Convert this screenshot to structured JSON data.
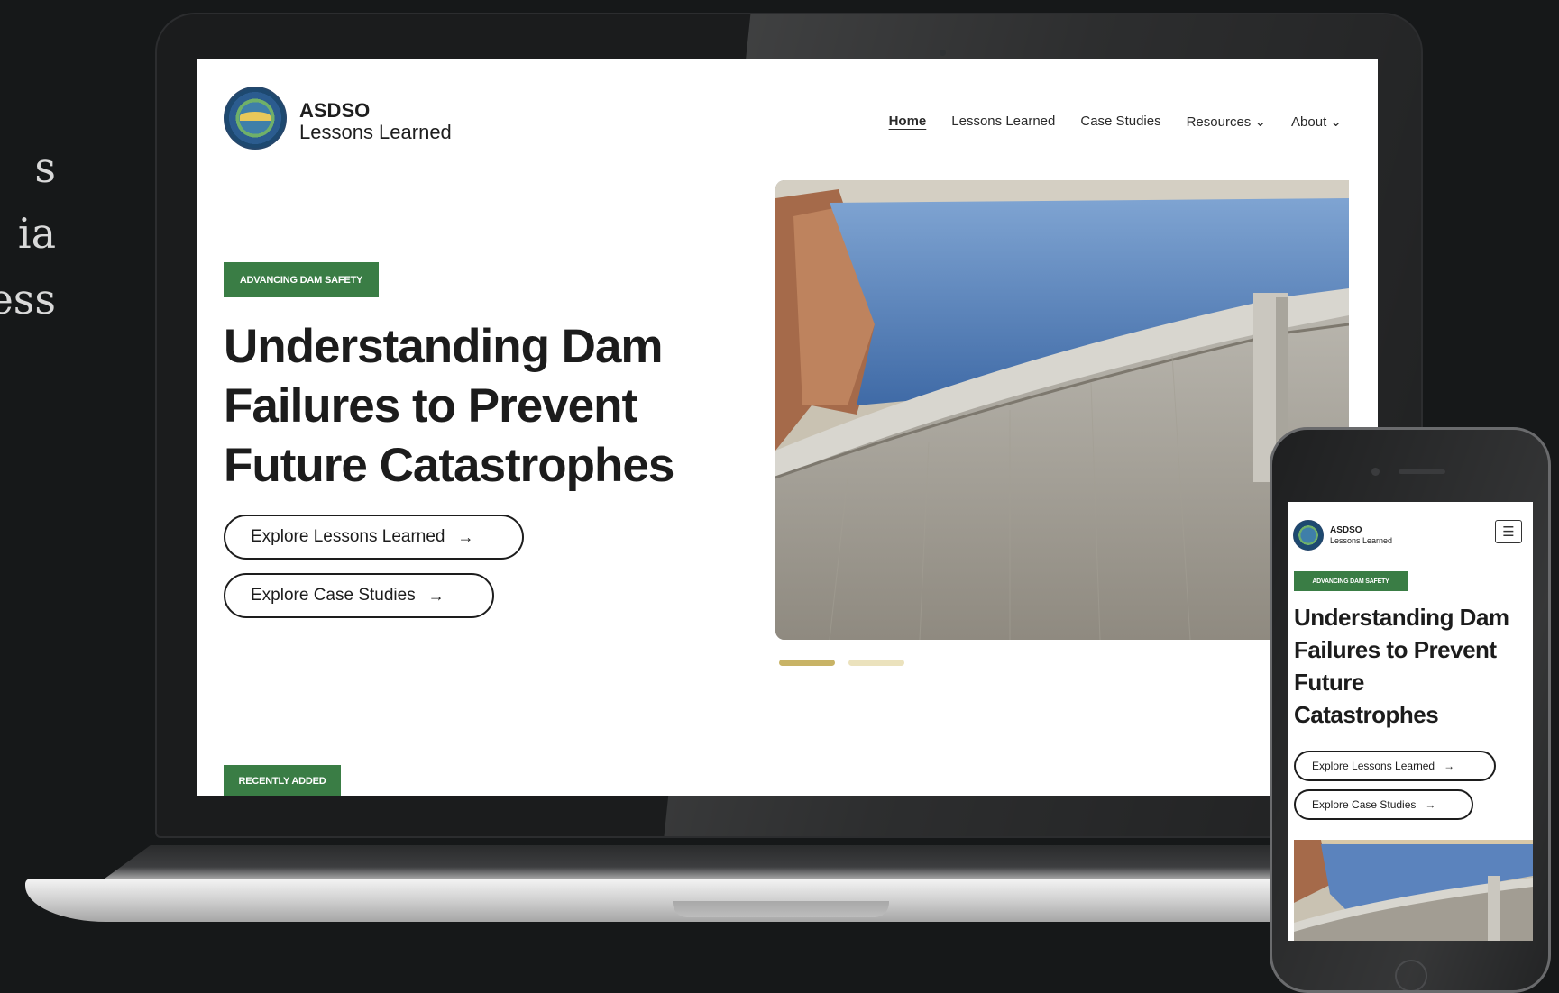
{
  "side_text": [
    "s",
    "ia",
    "ess"
  ],
  "site": {
    "brand_line1": "ASDSO",
    "brand_line2": "Lessons Learned"
  },
  "nav": {
    "items": [
      {
        "label": "Home",
        "active": true
      },
      {
        "label": "Lessons Learned"
      },
      {
        "label": "Case Studies"
      },
      {
        "label": "Resources",
        "has_dropdown": true
      },
      {
        "label": "About",
        "has_dropdown": true
      }
    ],
    "dropdown_glyph": "⌄"
  },
  "hero": {
    "badge": "ADVANCING DAM SAFETY",
    "title_lines": [
      "Understanding Dam",
      "Failures to Prevent",
      "Future Catastrophes"
    ],
    "buttons": [
      {
        "label": "Explore Lessons Learned",
        "icon": "arrow-right-icon"
      },
      {
        "label": "Explore Case Studies",
        "icon": "arrow-right-icon"
      }
    ],
    "arrow_glyph": "→",
    "image": "dam-reservoir-photo",
    "slide_count": 2,
    "active_slide": 1
  },
  "recent": {
    "badge": "RECENTLY ADDED"
  },
  "mobile": {
    "brand_line1": "ASDSO",
    "brand_line2": "Lessons Learned",
    "menu_icon": "menu-icon",
    "menu_glyph": "☰",
    "badge": "ADVANCING DAM SAFETY",
    "title_lines": [
      "Understanding Dam",
      "Failures to Prevent",
      "Future",
      "Catastrophes"
    ],
    "buttons": [
      {
        "label": "Explore Lessons Learned"
      },
      {
        "label": "Explore Case Studies"
      }
    ]
  },
  "colors": {
    "background": "#161819",
    "badge_green": "#3a7d45",
    "slide_active": "#c8b366",
    "slide_inactive": "#ebe2bd",
    "text_dark": "#1c1c1c"
  }
}
